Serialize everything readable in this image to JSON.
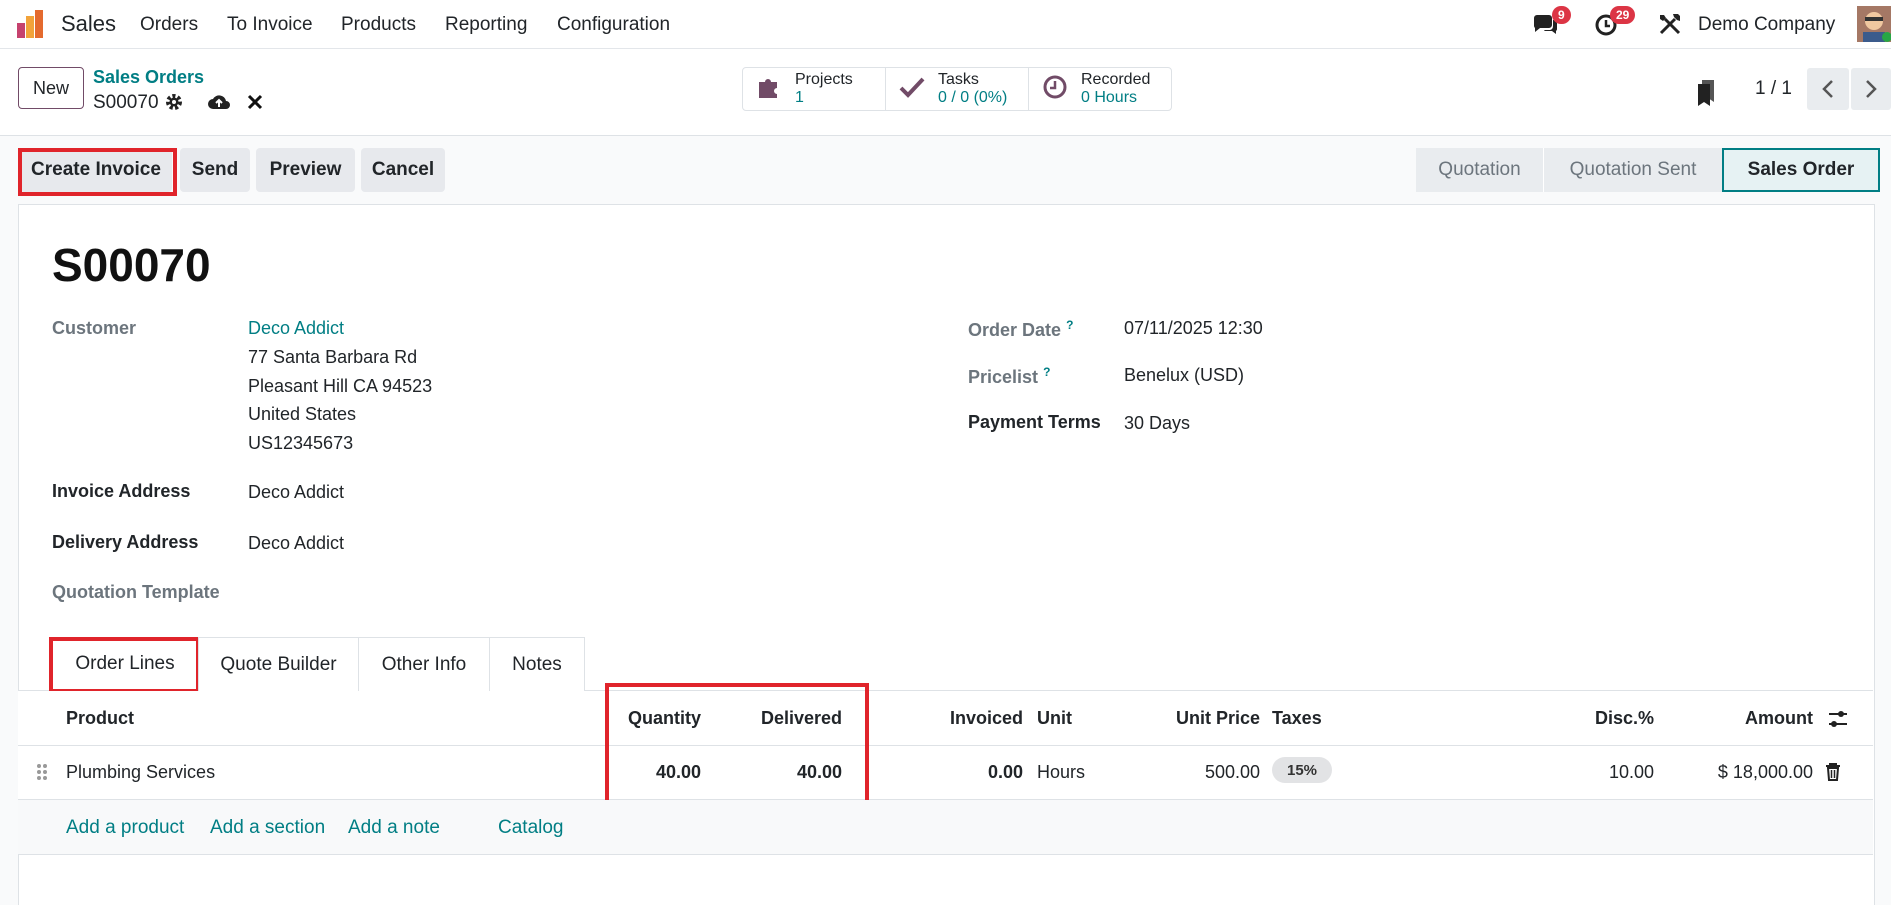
{
  "nav": {
    "app": "Sales",
    "menu": [
      "Orders",
      "To Invoice",
      "Products",
      "Reporting",
      "Configuration"
    ],
    "messages_count": "9",
    "activities_count": "29",
    "company": "Demo Company"
  },
  "control": {
    "new_label": "New",
    "breadcrumb": "Sales Orders",
    "record": "S00070",
    "stats": {
      "projects_label": "Projects",
      "projects_value": "1",
      "tasks_label": "Tasks",
      "tasks_value": "0 / 0 (0%)",
      "recorded_label": "Recorded",
      "recorded_value": "0 Hours"
    },
    "pager": "1 / 1"
  },
  "actions": {
    "create_invoice": "Create Invoice",
    "send": "Send",
    "preview": "Preview",
    "cancel": "Cancel"
  },
  "status": [
    "Quotation",
    "Quotation Sent",
    "Sales Order"
  ],
  "form": {
    "title": "S00070",
    "customer_label": "Customer",
    "customer_name": "Deco Addict",
    "address": [
      "77 Santa Barbara Rd",
      "Pleasant Hill CA 94523",
      "United States",
      "US12345673"
    ],
    "invoice_address_label": "Invoice Address",
    "invoice_address": "Deco Addict",
    "delivery_address_label": "Delivery Address",
    "delivery_address": "Deco Addict",
    "quotation_template_label": "Quotation Template",
    "order_date_label": "Order Date",
    "order_date": "07/11/2025 12:30",
    "pricelist_label": "Pricelist",
    "pricelist": "Benelux (USD)",
    "payment_terms_label": "Payment Terms",
    "payment_terms": "30 Days",
    "help_mark": "?"
  },
  "tabs": [
    "Order Lines",
    "Quote Builder",
    "Other Info",
    "Notes"
  ],
  "table": {
    "headers": {
      "product": "Product",
      "quantity": "Quantity",
      "delivered": "Delivered",
      "invoiced": "Invoiced",
      "unit": "Unit",
      "unit_price": "Unit Price",
      "taxes": "Taxes",
      "disc": "Disc.%",
      "amount": "Amount"
    },
    "rows": [
      {
        "product": "Plumbing Services",
        "quantity": "40.00",
        "delivered": "40.00",
        "invoiced": "0.00",
        "unit": "Hours",
        "unit_price": "500.00",
        "tax": "15%",
        "disc": "10.00",
        "amount": "$ 18,000.00"
      }
    ],
    "add_product": "Add a product",
    "add_section": "Add a section",
    "add_note": "Add a note",
    "catalog": "Catalog"
  },
  "colors": {
    "accent": "#017e84",
    "brand": "#714B67",
    "highlight": "#e0242b"
  }
}
